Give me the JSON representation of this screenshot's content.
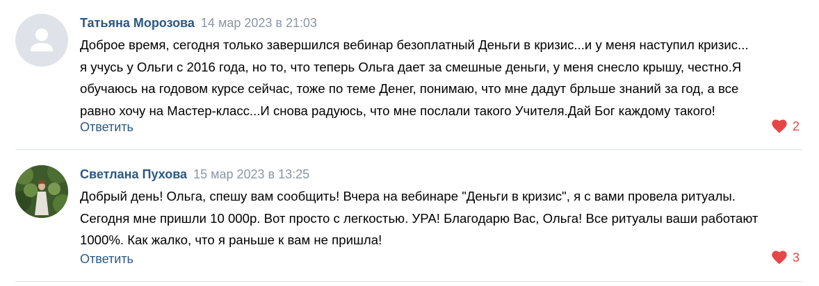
{
  "colors": {
    "author": "#2a5885",
    "date": "#8b96a3",
    "reply": "#2a5885",
    "like": "#e64646",
    "divider": "#dce1e6",
    "avatar_placeholder": "#dfe3e9"
  },
  "comments": [
    {
      "author": "Татьяна Морозова",
      "date": "14 мар 2023 в 21:03",
      "avatar": "default-user-icon",
      "text_lines": [
        "Доброе время, сегодня только завершился вебинар безоплатный Деньги в кризис...и у меня наступил кризис...",
        "я учусь у Ольги с 2016 года, но то, что теперь Ольга дает за смешные деньги, у меня снесло крышу, честно.Я",
        "обучаюсь на годовом курсе сейчас, тоже по теме Денег, понимаю, что мне дадут брльше знаний за год, а все",
        "равно хочу на Мастер-класс...И снова радуюсь, что мне послали такого Учителя.Дай Бог каждому такого!"
      ],
      "reply_label": "Ответить",
      "likes": "2",
      "like_icon": "heart-icon"
    },
    {
      "author": "Светлана Пухова",
      "date": "15 мар 2023 в 13:25",
      "avatar": "user-photo",
      "text_lines": [
        "Добрый день! Ольга, спешу вам сообщить! Вчера на вебинаре \"Деньги в кризис\", я с вами провела ритуалы.",
        "Сегодня мне пришли 10 000р. Вот просто с легкостью. УРА! Благодарю Вас, Ольга! Все ритуалы ваши работают",
        "1000%. Как жалко, что я раньше к вам не пришла!"
      ],
      "reply_label": "Ответить",
      "likes": "3",
      "like_icon": "heart-icon"
    }
  ]
}
